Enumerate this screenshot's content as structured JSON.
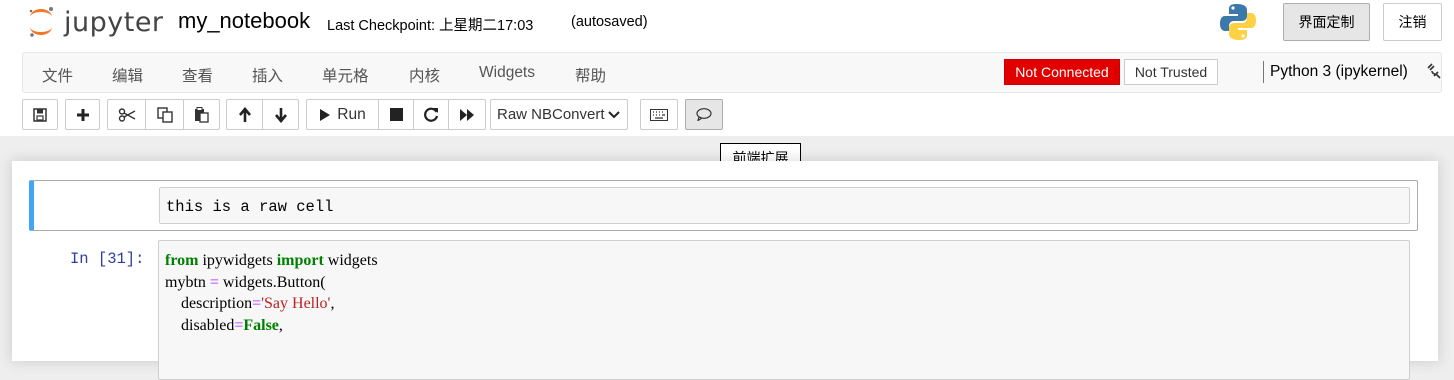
{
  "header": {
    "logo_text": "jupyter",
    "notebook_name": "my_notebook",
    "checkpoint": "Last Checkpoint: 上星期二17:03",
    "autosave": "(autosaved)",
    "custom_button": "界面定制",
    "logout_button": "注销"
  },
  "menubar": {
    "items": [
      "文件",
      "编辑",
      "查看",
      "插入",
      "单元格",
      "内核",
      "Widgets",
      "帮助"
    ],
    "not_connected": "Not Connected",
    "not_trusted": "Not Trusted",
    "kernel_name": "Python 3 (ipykernel)"
  },
  "toolbar": {
    "run_label": "Run",
    "cell_type": "Raw NBConvert",
    "tooltip": "前端扩展",
    "icons": [
      "save-icon",
      "plus-icon",
      "cut-icon",
      "copy-icon",
      "paste-icon",
      "arrow-up-icon",
      "arrow-down-icon",
      "play-icon",
      "stop-icon",
      "restart-icon",
      "fast-forward-icon",
      "keyboard-icon",
      "comment-icon"
    ]
  },
  "cells": {
    "raw_text": "this is a raw cell",
    "code_prompt": "In  [31]:",
    "code": {
      "l1_kw1": "from",
      "l1_mod": " ipywidgets ",
      "l1_kw2": "import",
      "l1_rest": " widgets",
      "l2_a": "mybtn ",
      "l2_eq": "=",
      "l2_b": " widgets.Button(",
      "l3_a": "    description",
      "l3_eq": "=",
      "l3_str": "'Say Hello'",
      "l3_c": ",",
      "l4_a": "    disabled",
      "l4_eq": "=",
      "l4_bool": "False",
      "l4_c": ","
    }
  },
  "colors": {
    "not_connected_bg": "#e00000",
    "selected_cell_bar": "#42a5f5",
    "prompt": "#303f9f",
    "keyword": "#008000",
    "string": "#ba2121"
  }
}
